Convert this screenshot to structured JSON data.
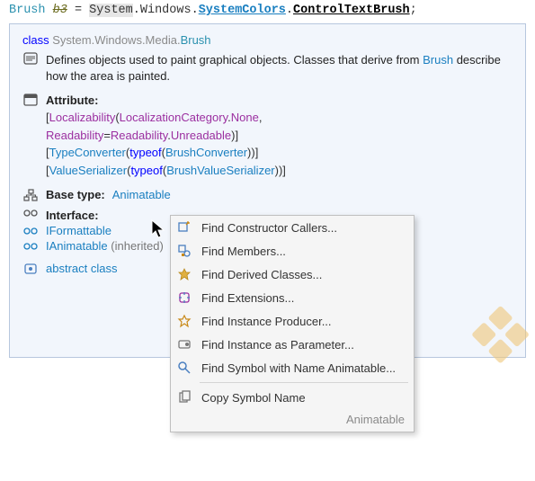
{
  "code": {
    "type": "Brush",
    "var": "b3",
    "eq": "=",
    "ns_hl": "System",
    "ns_rest": ".Windows.",
    "cls1": "SystemColors",
    "dot": ".",
    "member": "ControlTextBrush",
    "semi": ";"
  },
  "tooltip": {
    "kw": "class",
    "ns": "System.Windows.Media.",
    "cls": "Brush",
    "desc_pre": "Defines objects used to paint graphical objects. Classes that derive from ",
    "desc_link": "Brush",
    "desc_post": " describe how the area is painted.",
    "attr_title": "Attribute:",
    "attr_lines": [
      {
        "open": "[",
        "t1": "Localizability",
        "p1": "(",
        "t2": "LocalizationCategory",
        "dot": ".",
        "t3": "None",
        "close": ","
      },
      {
        "pre": "",
        "t1": "Readability",
        "eq": "=",
        "t2": "Readability",
        "dot": ".",
        "t3": "Unreadable",
        "close": ")]"
      },
      {
        "open": "[",
        "t1": "TypeConverter",
        "p1": "(",
        "kw": "typeof",
        "p2": "(",
        "t2": "BrushConverter",
        "close": "))]"
      },
      {
        "open": "[",
        "t1": "ValueSerializer",
        "p1": "(",
        "kw": "typeof",
        "p2": "(",
        "t2": "BrushValueSerializer",
        "close": "))]"
      }
    ],
    "base_title": "Base type:",
    "base_link": "Animatable",
    "if_title": "Interface:",
    "ifs": [
      {
        "name": "IFormattable",
        "inh": ""
      },
      {
        "name": "IAnimatable",
        "inh": " (inherited)"
      }
    ],
    "abs": "abstract class"
  },
  "ctx": {
    "items": [
      {
        "label": "Find Constructor Callers..."
      },
      {
        "label": "Find Members..."
      },
      {
        "label": "Find Derived Classes..."
      },
      {
        "label": "Find Extensions..."
      },
      {
        "label": "Find Instance Producer..."
      },
      {
        "label": "Find Instance as Parameter..."
      },
      {
        "label": "Find Symbol with Name Animatable..."
      }
    ],
    "copy": "Copy Symbol Name",
    "caption": "Animatable"
  }
}
